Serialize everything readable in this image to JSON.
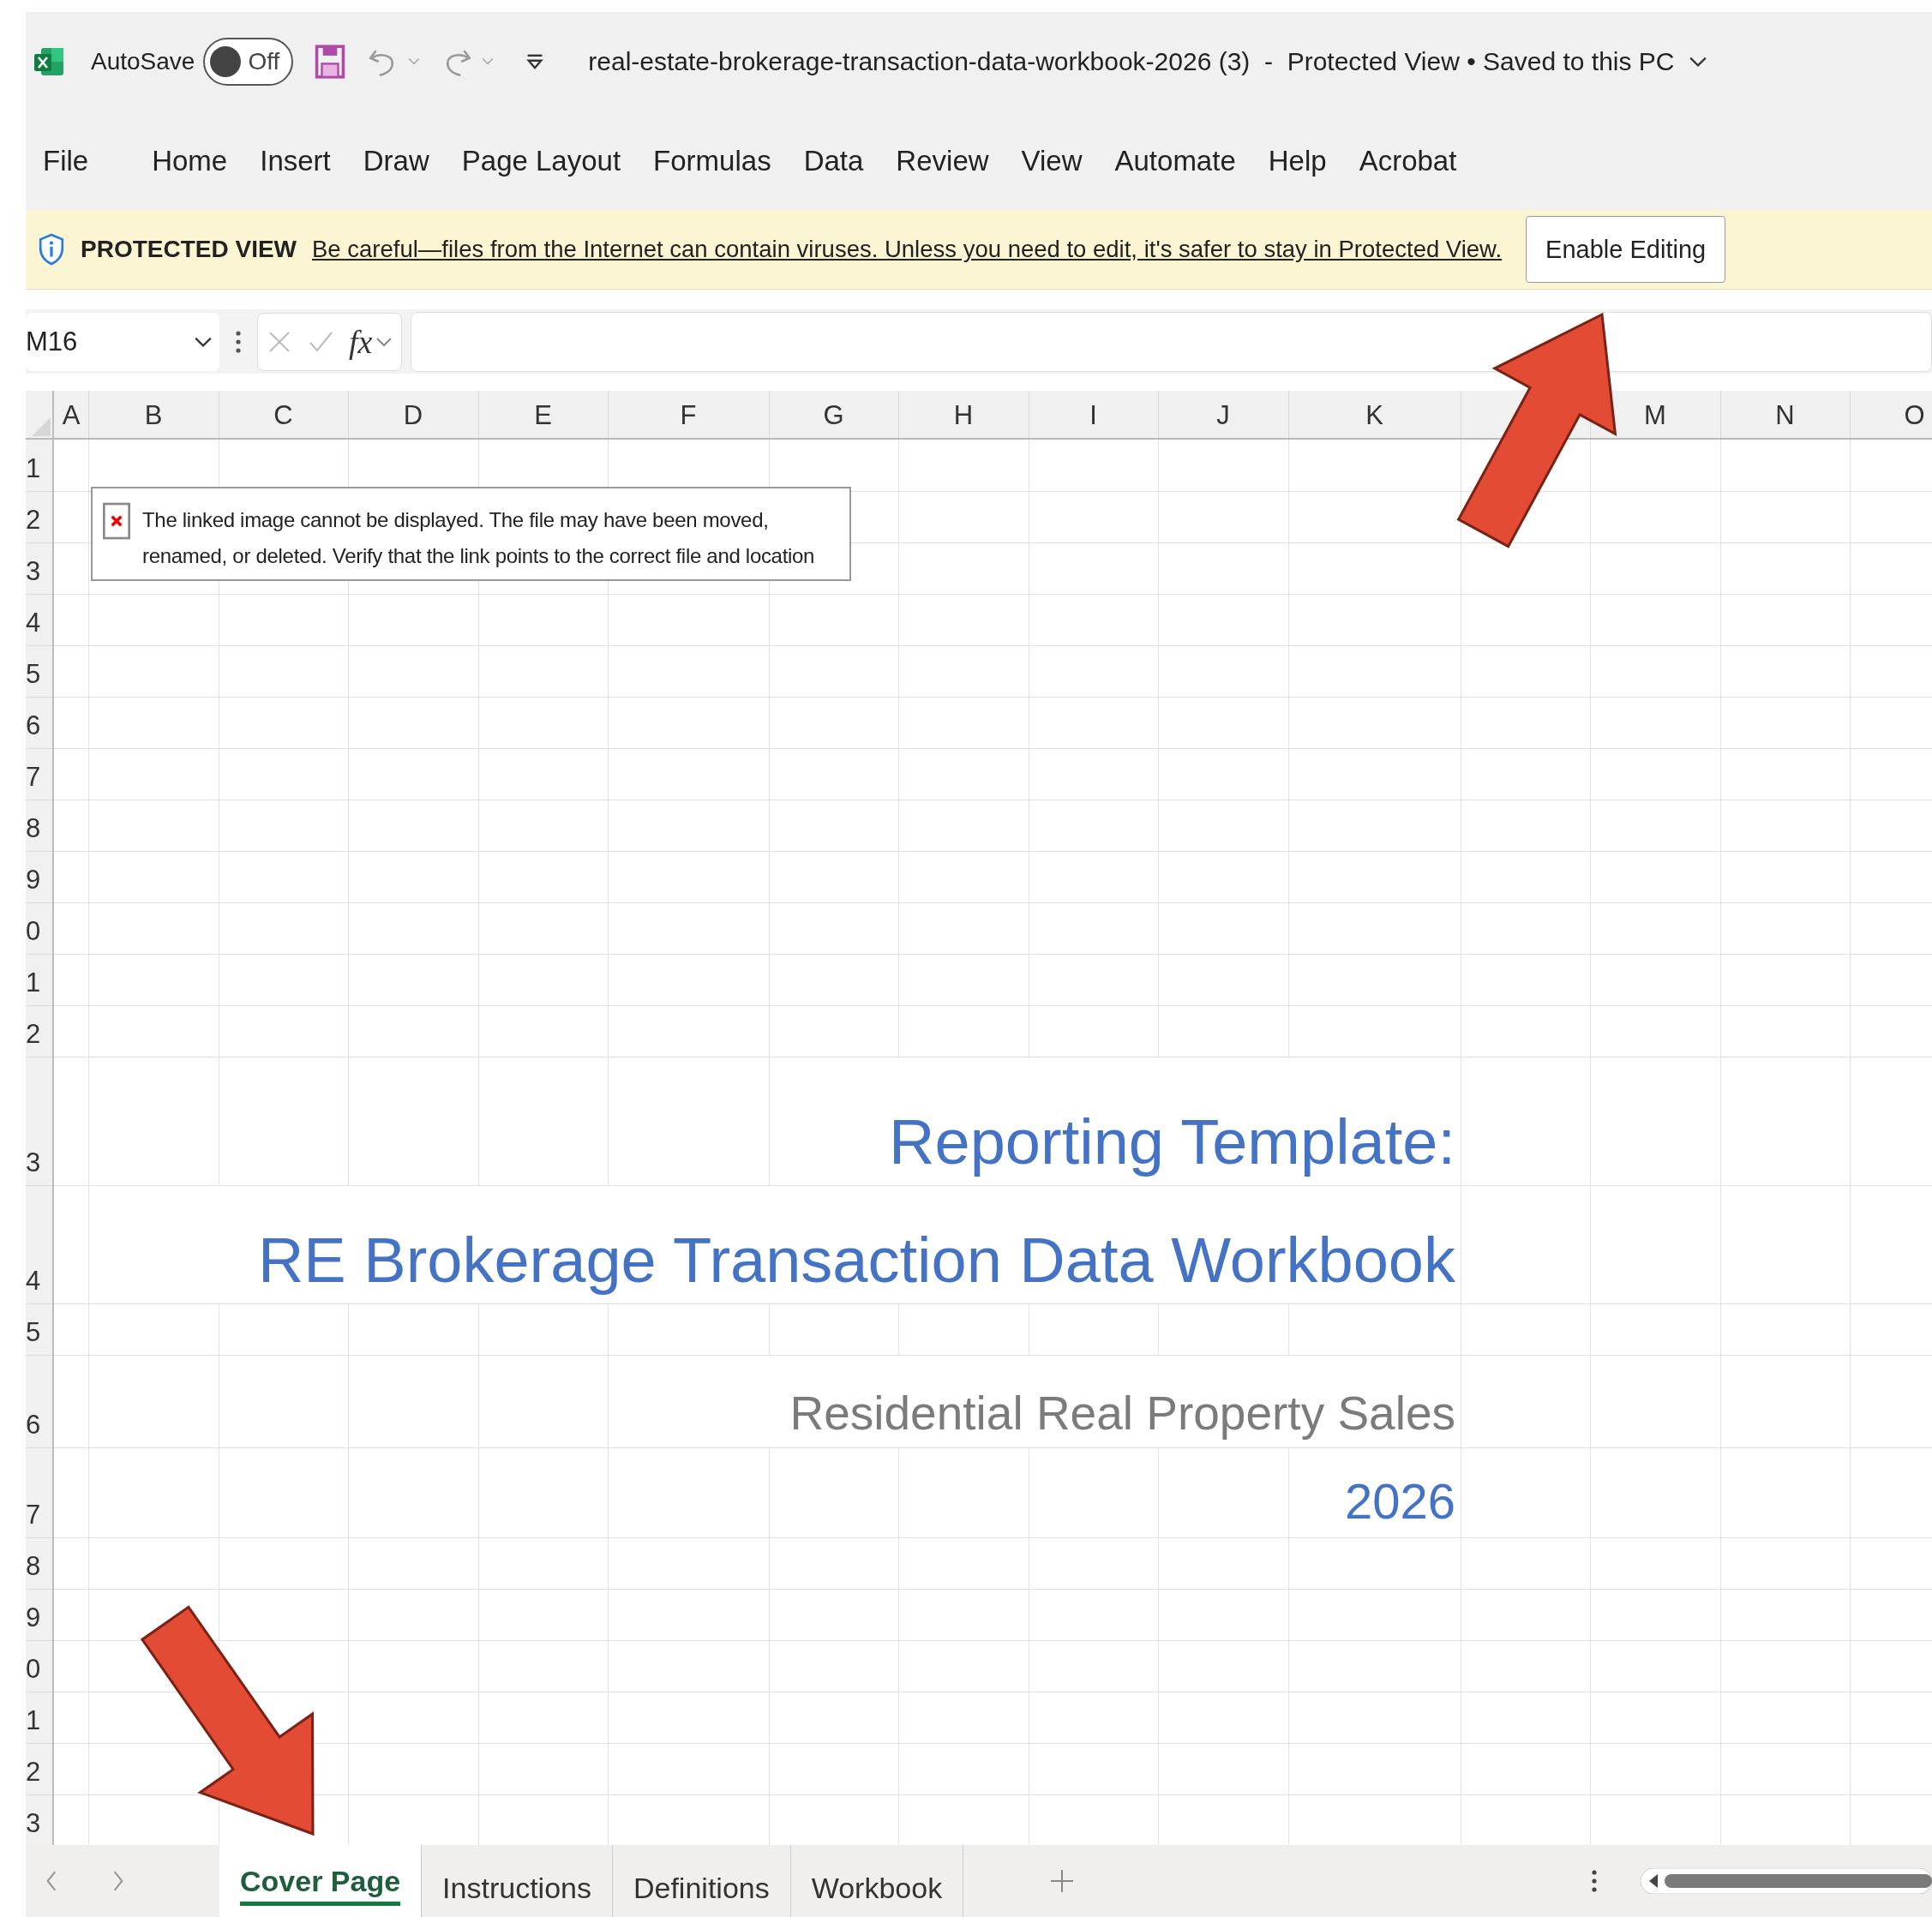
{
  "title_bar": {
    "autosave_label": "AutoSave",
    "autosave": {
      "on": false,
      "label": "Off"
    },
    "document_title": "real-estate-brokerage-transaction-data-workbook-2026 (3)  -  Protected View • Saved to this PC"
  },
  "ribbon_tabs": [
    "File",
    "Home",
    "Insert",
    "Draw",
    "Page Layout",
    "Formulas",
    "Data",
    "Review",
    "View",
    "Automate",
    "Help",
    "Acrobat"
  ],
  "protected_view": {
    "heading": "PROTECTED VIEW",
    "message": "Be careful—files from the Internet can contain viruses. Unless you need to edit, it's safer to stay in Protected View.",
    "button": "Enable Editing"
  },
  "formula_bar": {
    "name_box": "M16",
    "function_button": "fx"
  },
  "sheet": {
    "columns": [
      "A",
      "B",
      "C",
      "D",
      "E",
      "F",
      "G",
      "H",
      "I",
      "J",
      "K",
      "M",
      "N",
      "O"
    ],
    "broken_image": {
      "message": "The linked image cannot be displayed.  The file may have been moved, renamed, or deleted. Verify that the link points to the correct file and location"
    },
    "rows": [
      {
        "label": "1"
      },
      {
        "label": "2"
      },
      {
        "label": "3"
      },
      {
        "label": "4"
      },
      {
        "label": "5"
      },
      {
        "label": "6"
      },
      {
        "label": "7"
      },
      {
        "label": "8"
      },
      {
        "label": "9"
      },
      {
        "label": "0"
      },
      {
        "label": "1"
      },
      {
        "label": "2"
      },
      {
        "label": "3",
        "kind": "title",
        "text": "Reporting Template:"
      },
      {
        "label": "4",
        "kind": "title",
        "text": "RE Brokerage Transaction Data Workbook"
      },
      {
        "label": "5"
      },
      {
        "label": "6",
        "kind": "subtitle",
        "text": "Residential Real Property Sales"
      },
      {
        "label": "7",
        "kind": "year",
        "text": "2026"
      },
      {
        "label": "8"
      },
      {
        "label": "9"
      },
      {
        "label": "0"
      },
      {
        "label": "1"
      },
      {
        "label": "2"
      },
      {
        "label": "3"
      }
    ]
  },
  "sheet_tabs": [
    {
      "label": "Cover Page",
      "selected": true
    },
    {
      "label": "Instructions",
      "selected": false
    },
    {
      "label": "Definitions",
      "selected": false
    },
    {
      "label": "Workbook",
      "selected": false
    }
  ]
}
